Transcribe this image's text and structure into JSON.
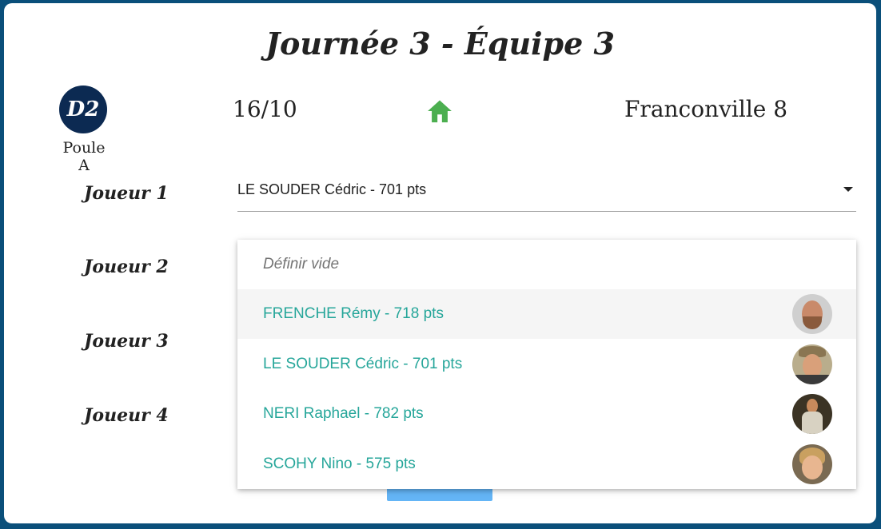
{
  "header": {
    "title": "Journée 3 - Équipe 3",
    "division": "D2",
    "poule": "Poule A",
    "date": "16/10",
    "home_icon": "home-icon",
    "opponent": "Franconville 8"
  },
  "players": {
    "labels": [
      "Joueur 1",
      "Joueur 2",
      "Joueur 3",
      "Joueur 4"
    ],
    "joueur1_value": "LE SOUDER Cédric - 701 pts"
  },
  "dropdown": {
    "empty_option": "Définir vide",
    "options": [
      {
        "label": "FRENCHE Rémy - 718 pts"
      },
      {
        "label": "LE SOUDER Cédric - 701 pts"
      },
      {
        "label": "NERI Raphael - 782 pts"
      },
      {
        "label": "SCOHY Nino - 575 pts"
      }
    ]
  },
  "colors": {
    "background": "#0a4f7a",
    "badge": "#0c2a52",
    "home_icon": "#4caf50",
    "option_text": "#26a69a",
    "submit_button": "#64b5f6"
  }
}
